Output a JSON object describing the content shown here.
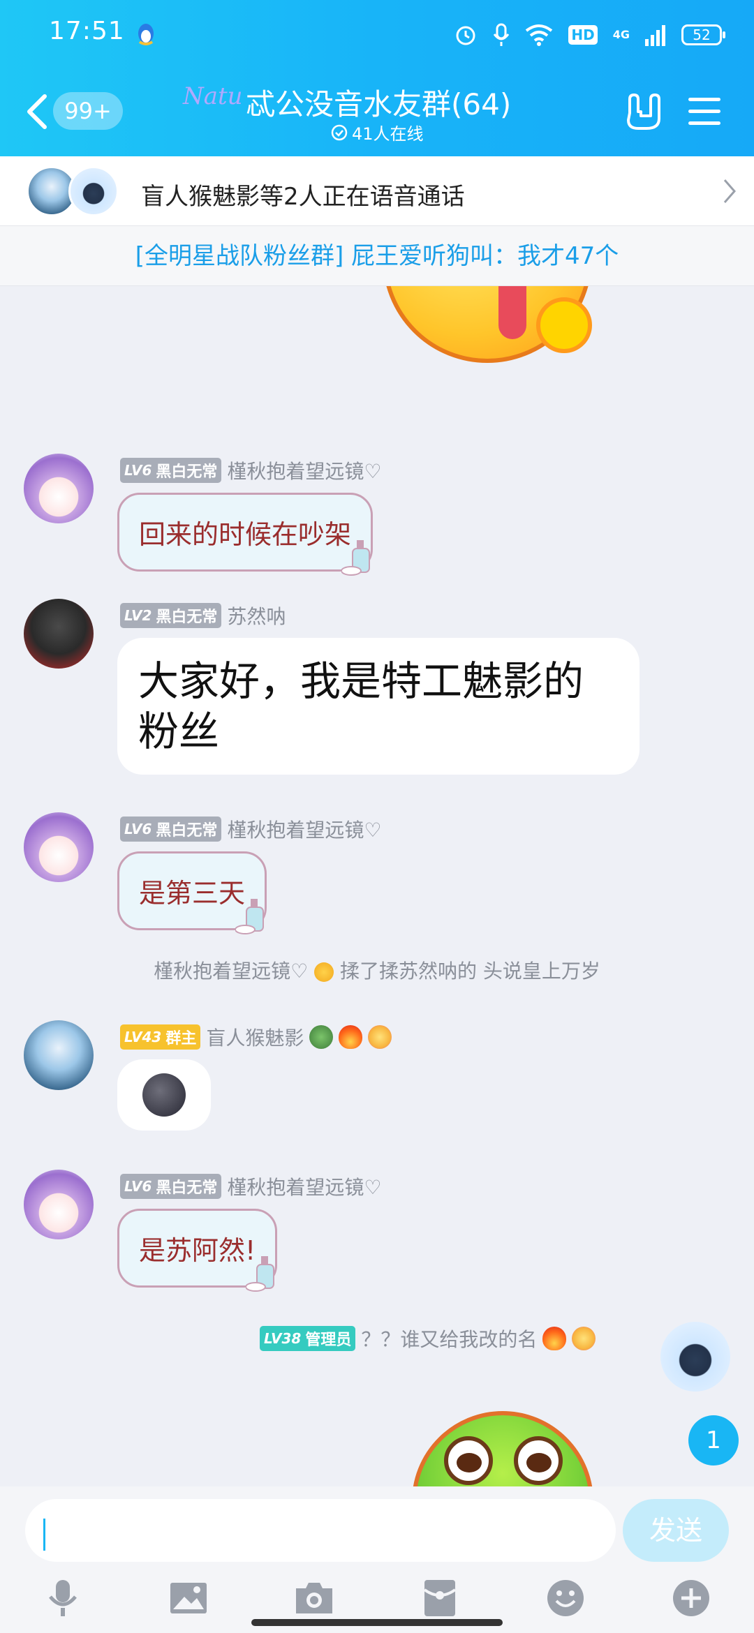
{
  "status_bar": {
    "time": "17:51",
    "hd": "HD",
    "network": "4G",
    "battery": "52"
  },
  "header": {
    "unread_count": "99+",
    "logo_text": "Natu",
    "group_title": "忒公没音水友群(64)",
    "online_text": "41人在线"
  },
  "voice_call": {
    "text": "盲人猴魅影等2人正在语音通话"
  },
  "notice": {
    "text": "[全明星战队粉丝群] 屁王爱听狗叫：我才47个"
  },
  "messages": [
    {
      "level": "LV6",
      "title": "黑白无常",
      "nick": "槿秋抱着望远镜♡",
      "text": "回来的时候在吵架"
    },
    {
      "level": "LV2",
      "title": "黑白无常",
      "nick": "苏然呐",
      "text": "大家好，我是特工魅影的粉丝"
    },
    {
      "level": "LV6",
      "title": "黑白无常",
      "nick": "槿秋抱着望远镜♡",
      "text": "是第三天"
    },
    {
      "level": "LV43",
      "title": "群主",
      "nick": "盲人猴魅影"
    },
    {
      "level": "LV6",
      "title": "黑白无常",
      "nick": "槿秋抱着望远镜♡",
      "text": "是苏阿然!"
    },
    {
      "level": "LV38",
      "title": "管理员",
      "nick": "？？谁又给我改的名"
    }
  ],
  "system_note": {
    "part1": "槿秋抱着望远镜♡",
    "part2": "揉了揉苏然呐的 头说皇上万岁"
  },
  "unread_badge": "1",
  "input": {
    "value": "",
    "placeholder": "",
    "send_label": "发送"
  },
  "colors": {
    "header_gradient_start": "#1fc7f6",
    "header_gradient_end": "#16a9f7",
    "accent": "#19b6f4",
    "notice_text": "#1a9ee8",
    "owner_badge": "#f7c22d",
    "admin_badge": "#35cbc0"
  },
  "icons": {
    "back": "chevron-left-icon",
    "hand": "rock-hand-icon",
    "menu": "hamburger-menu-icon",
    "toolbar": [
      "microphone-icon",
      "image-icon",
      "camera-icon",
      "red-packet-icon",
      "emoji-icon",
      "plus-icon"
    ]
  }
}
